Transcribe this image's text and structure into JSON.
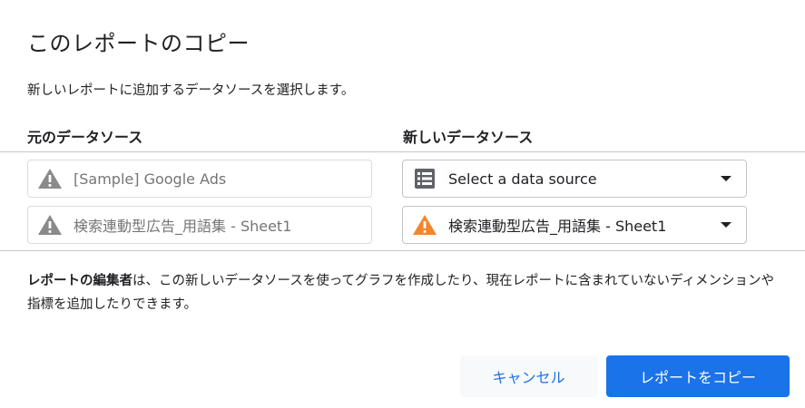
{
  "dialog": {
    "title": "このレポートのコピー",
    "subtitle": "新しいレポートに追加するデータソースを選択します。"
  },
  "columns": {
    "original_header": "元のデータソース",
    "new_header": "新しいデータソース"
  },
  "rows": [
    {
      "original": "[Sample] Google Ads",
      "original_icon": "warning-icon",
      "new": "Select a data source",
      "new_icon": "data-source-icon"
    },
    {
      "original": "検索連動型広告_用語集 - Sheet1",
      "original_icon": "warning-icon",
      "new": "検索連動型広告_用語集 - Sheet1",
      "new_icon": "warning-icon"
    }
  ],
  "note": {
    "bold": "レポートの編集者",
    "text": "は、この新しいデータソースを使ってグラフを作成したり、現在レポートに含まれていないディメンションや指標を追加したりできます。"
  },
  "buttons": {
    "cancel": "キャンセル",
    "copy": "レポートをコピー"
  },
  "colors": {
    "accent": "#1a73e8",
    "warning_gray": "#8a8a8a",
    "warning_orange": "#f4852d",
    "icon_gray": "#5f6368"
  }
}
